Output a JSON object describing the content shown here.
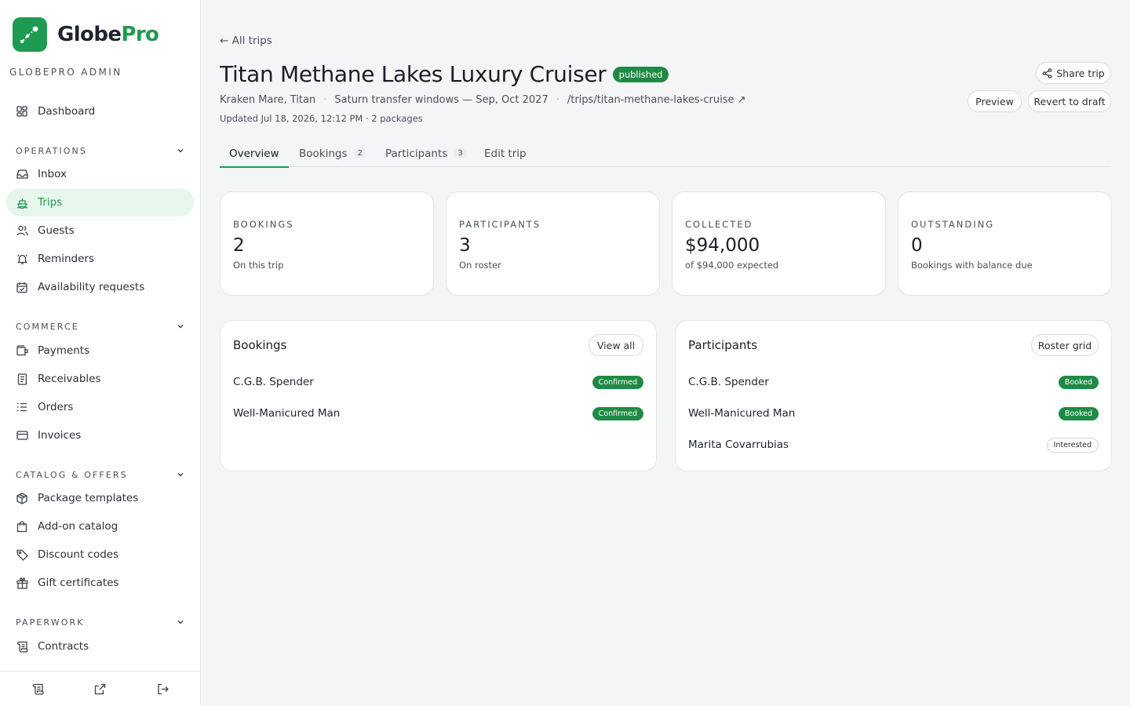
{
  "brand": {
    "name_a": "Globe",
    "name_b": "Pro",
    "subtitle": "GLOBEPRO ADMIN",
    "accent": "#1f9a52"
  },
  "nav": {
    "dashboard": "Dashboard",
    "sections": [
      {
        "label": "OPERATIONS",
        "items": [
          "Inbox",
          "Trips",
          "Guests",
          "Reminders",
          "Availability requests"
        ]
      },
      {
        "label": "COMMERCE",
        "items": [
          "Payments",
          "Receivables",
          "Orders",
          "Invoices"
        ]
      },
      {
        "label": "CATALOG & OFFERS",
        "items": [
          "Package templates",
          "Add-on catalog",
          "Discount codes",
          "Gift certificates"
        ]
      },
      {
        "label": "PAPERWORK",
        "items": [
          "Contracts"
        ]
      }
    ],
    "active": "Trips"
  },
  "trip": {
    "back": "← All trips",
    "title": "Titan Methane Lakes Luxury Cruiser",
    "status": "published",
    "location": "Kraken Mare, Titan",
    "window": "Saturn transfer windows — Sep, Oct 2027",
    "slug": "/trips/titan-methane-lakes-cruise ↗",
    "updated": "Updated Jul 18, 2026, 12:12 PM · 2 packages"
  },
  "actions": {
    "share": "Share trip",
    "preview": "Preview",
    "revert": "Revert to draft"
  },
  "tabs": [
    {
      "label": "Overview",
      "count": ""
    },
    {
      "label": "Bookings",
      "count": "2"
    },
    {
      "label": "Participants",
      "count": "3"
    },
    {
      "label": "Edit trip",
      "count": ""
    }
  ],
  "stats": [
    {
      "label": "BOOKINGS",
      "value": "2",
      "sub": "On this trip"
    },
    {
      "label": "PARTICIPANTS",
      "value": "3",
      "sub": "On roster"
    },
    {
      "label": "COLLECTED",
      "value": "$94,000",
      "sub": "of $94,000 expected"
    },
    {
      "label": "OUTSTANDING",
      "value": "0",
      "sub": "Bookings with balance due"
    }
  ],
  "bookings_panel": {
    "title": "Bookings",
    "button": "View all",
    "rows": [
      {
        "name": "C.G.B. Spender",
        "status": "Confirmed"
      },
      {
        "name": "Well-Manicured Man",
        "status": "Confirmed"
      }
    ]
  },
  "participants_panel": {
    "title": "Participants",
    "button": "Roster grid",
    "rows": [
      {
        "name": "C.G.B. Spender",
        "status": "Booked"
      },
      {
        "name": "Well-Manicured Man",
        "status": "Booked"
      },
      {
        "name": "Marita Covarrubias",
        "status": "Interested"
      }
    ]
  }
}
